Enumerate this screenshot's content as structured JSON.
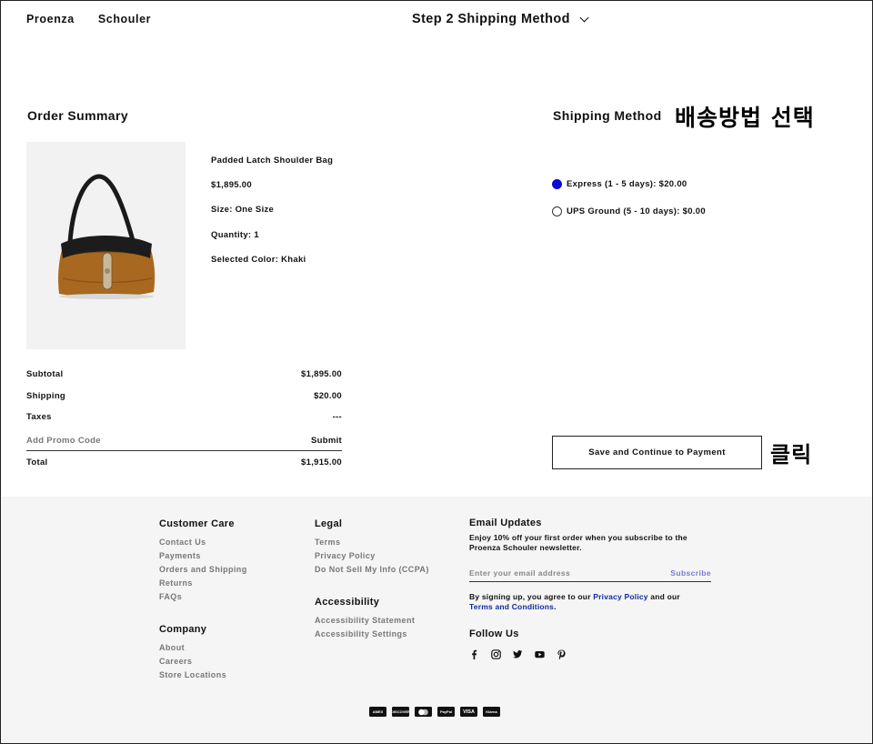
{
  "header": {
    "brand_part1": "Proenza",
    "brand_part2": "Schouler",
    "step_label": "Step 2 Shipping Method"
  },
  "order_summary": {
    "title": "Order Summary",
    "product": {
      "name": "Padded Latch Shoulder Bag",
      "price": "$1,895.00",
      "size": "Size:  One Size",
      "quantity": "Quantity:  1",
      "color": "Selected Color: Khaki"
    },
    "rows": {
      "subtotal_label": "Subtotal",
      "subtotal_value": "$1,895.00",
      "shipping_label": "Shipping",
      "shipping_value": "$20.00",
      "taxes_label": "Taxes",
      "taxes_value": "---",
      "promo_placeholder": "Add Promo Code",
      "promo_submit": "Submit",
      "total_label": "Total",
      "total_value": "$1,915.00"
    }
  },
  "shipping": {
    "title": "Shipping Method",
    "annotation_select": "배송방법 선택",
    "options": [
      {
        "label": "Express (1 - 5 days): $20.00",
        "selected": true
      },
      {
        "label": "UPS Ground (5 - 10 days): $0.00",
        "selected": false
      }
    ],
    "save_button": "Save and Continue to Payment",
    "annotation_click": "클릭"
  },
  "footer": {
    "customer_care": {
      "title": "Customer Care",
      "links": [
        "Contact Us",
        "Payments",
        "Orders and Shipping",
        "Returns",
        "FAQs"
      ]
    },
    "company": {
      "title": "Company",
      "links": [
        "About",
        "Careers",
        "Store Locations"
      ]
    },
    "legal": {
      "title": "Legal",
      "links": [
        "Terms",
        "Privacy Policy",
        "Do Not Sell My Info (CCPA)"
      ]
    },
    "accessibility": {
      "title": "Accessibility",
      "links": [
        "Accessibility Statement",
        "Accessibility Settings"
      ]
    },
    "email": {
      "title": "Email Updates",
      "description": "Enjoy 10% off your first order when you subscribe to the Proenza Schouler newsletter.",
      "placeholder": "Enter your email address",
      "subscribe": "Subscribe",
      "consent_prefix": "By signing up, you agree to our ",
      "privacy_link": "Privacy Policy",
      "consent_mid": " and our ",
      "terms_link": "Terms and Conditions",
      "consent_end": "."
    },
    "follow": {
      "title": "Follow Us",
      "icons": [
        "facebook-icon",
        "instagram-icon",
        "twitter-icon",
        "youtube-icon",
        "pinterest-icon"
      ]
    },
    "payment_methods": [
      "AMEX",
      "DISCOVER",
      "MC",
      "PayPal",
      "VISA",
      "Klarna"
    ]
  },
  "colors": {
    "radio_selected": "#0b0bd6",
    "footer_bg": "#f5f5f5",
    "link_blue": "#0f2a9c"
  }
}
